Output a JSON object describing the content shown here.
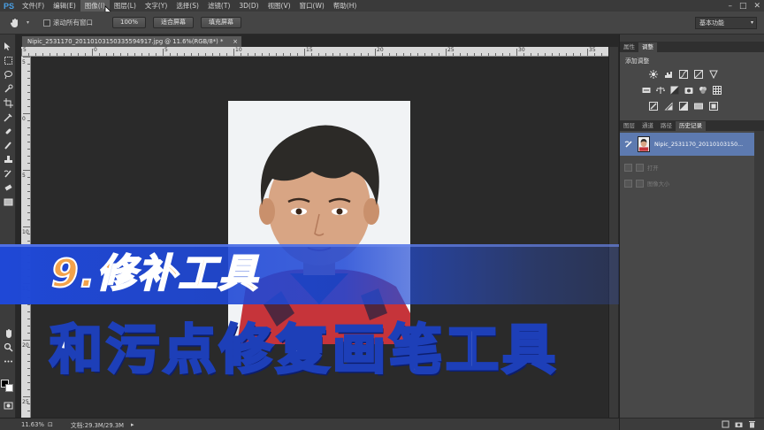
{
  "app": {
    "logo": "PS"
  },
  "menu": {
    "items": [
      "文件(F)",
      "编辑(E)",
      "图像(I)",
      "图层(L)",
      "文字(Y)",
      "选择(S)",
      "滤镜(T)",
      "3D(D)",
      "视图(V)",
      "窗口(W)",
      "帮助(H)"
    ],
    "active_index": 2
  },
  "options": {
    "scroll_all_label": "滚动所有窗口",
    "zoom_btn": "100%",
    "fit_screen_btn": "适合屏幕",
    "fill_screen_btn": "填充屏幕",
    "workspace": "基本功能"
  },
  "document": {
    "tab_title": "Nipic_2531170_20110103150335594917.jpg @ 11.6%(RGB/8*) *",
    "close": "×"
  },
  "rulers": {
    "top_labels": [
      "5",
      "0",
      "5",
      "10",
      "15",
      "20",
      "25",
      "30",
      "35"
    ],
    "left_labels": [
      "5",
      "0",
      "5",
      "10",
      "15",
      "20",
      "25"
    ]
  },
  "status": {
    "zoom": "11.63%",
    "doc_info": "文档:29.3M/29.3M"
  },
  "panels": {
    "top_tabs": [
      "属性",
      "调整"
    ],
    "top_active": 1,
    "adjust_title": "添加调整",
    "bottom_tabs": [
      "图层",
      "通道",
      "路径",
      "历史记录"
    ],
    "bottom_active": 3,
    "history": {
      "snapshot_name": "Nipic_2531170_20110103150...",
      "states": [
        "打开",
        "图像大小"
      ]
    }
  },
  "overlay": {
    "title": "9.修补工具",
    "subtitle": "和污点修复画笔工具",
    "title_color": "#f2a24a",
    "subtitle_stroke": "#1d3fb8",
    "band_color": "#1f48d6"
  }
}
